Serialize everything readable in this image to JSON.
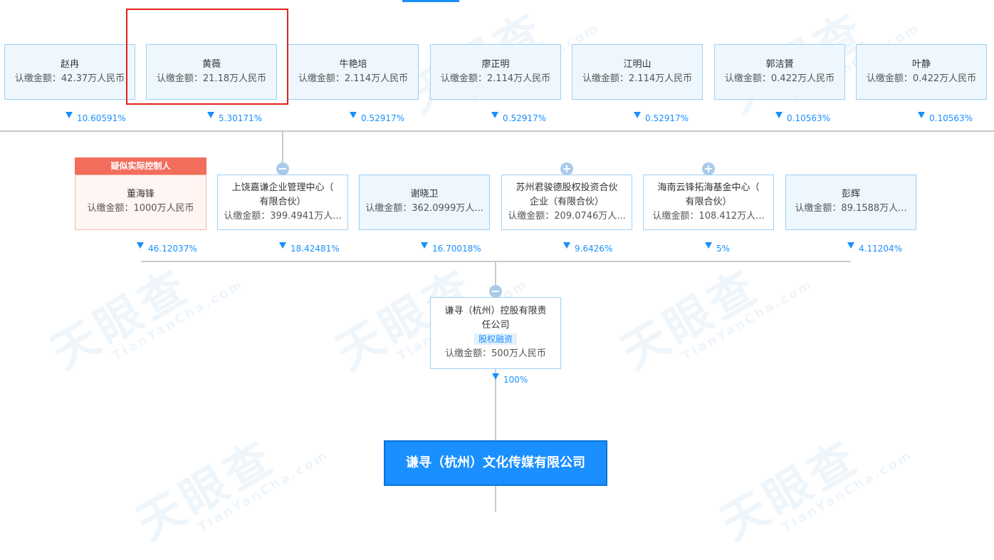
{
  "watermark": {
    "brand": "天眼查",
    "domain": "TianYanCha.com"
  },
  "top_row": [
    {
      "name": "赵冉",
      "amount": "认缴金额：42.37万人民币",
      "percent": "10.60591%"
    },
    {
      "name": "黄薇",
      "amount": "认缴金额：21.18万人民币",
      "percent": "5.30171%"
    },
    {
      "name": "牛艳培",
      "amount": "认缴金额：2.114万人民币",
      "percent": "0.52917%"
    },
    {
      "name": "廖正明",
      "amount": "认缴金额：2.114万人民币",
      "percent": "0.52917%"
    },
    {
      "name": "江明山",
      "amount": "认缴金额：2.114万人民币",
      "percent": "0.52917%"
    },
    {
      "name": "郭洁贇",
      "amount": "认缴金额：0.422万人民币",
      "percent": "0.10563%"
    },
    {
      "name": "叶静",
      "amount": "认缴金额：0.422万人民币",
      "percent": "0.10563%"
    }
  ],
  "controller_badge": "疑似实际控制人",
  "middle_row": [
    {
      "name_lines": [
        "董海锋"
      ],
      "amount": "认缴金额：1000万人民币",
      "percent": "46.12037%"
    },
    {
      "name_lines": [
        "上饶嘉谦企业管理中心（",
        "有限合伙）"
      ],
      "amount": "认缴金额：399.4941万人...",
      "percent": "18.42481%",
      "toggle": "−"
    },
    {
      "name_lines": [
        "谢晓卫"
      ],
      "amount": "认缴金额：362.0999万人...",
      "percent": "16.70018%"
    },
    {
      "name_lines": [
        "苏州君骏德股权投资合伙",
        "企业（有限合伙）"
      ],
      "amount": "认缴金额：209.0746万人...",
      "percent": "9.6426%",
      "toggle": "+"
    },
    {
      "name_lines": [
        "海南云锋拓海基金中心（",
        "有限合伙）"
      ],
      "amount": "认缴金额：108.412万人...",
      "percent": "5%",
      "toggle": "+"
    },
    {
      "name_lines": [
        "彭辉"
      ],
      "amount": "认缴金额：89.1588万人...",
      "percent": "4.11204%"
    }
  ],
  "holding": {
    "toggle": "−",
    "name_lines": [
      "谦寻（杭州）控股有限责",
      "任公司"
    ],
    "tag": "股权融资",
    "amount": "认缴金额：500万人民币",
    "percent": "100%"
  },
  "target_company": "谦寻（杭州）文化传媒有限公司"
}
